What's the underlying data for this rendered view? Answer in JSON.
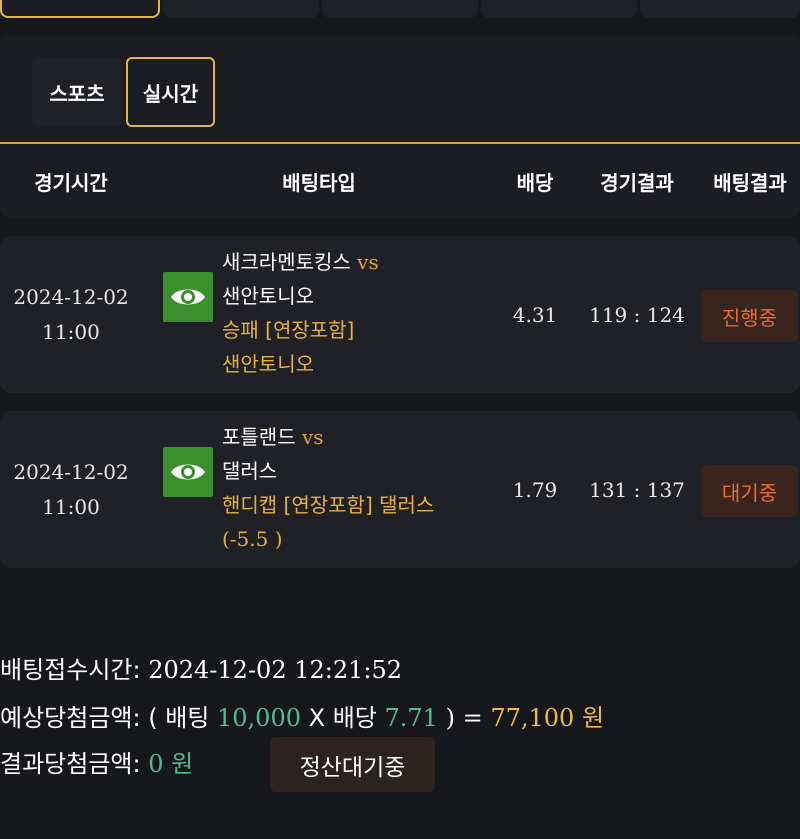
{
  "tabs": {
    "sports_label": "스포츠",
    "live_label": "실시간"
  },
  "table_headers": {
    "time": "경기시간",
    "bet_type": "배팅타입",
    "odds": "배당",
    "game_result": "경기결과",
    "bet_result": "배팅결과"
  },
  "bets": [
    {
      "date": "2024-12-02",
      "time": "11:00",
      "home": "새크라멘토킹스",
      "vs": "vs",
      "away": "샌안토니오",
      "market": "승패 [연장포함]",
      "pick": "샌안토니오",
      "odds": "4.31",
      "score": "119 : 124",
      "status": "진행중"
    },
    {
      "date": "2024-12-02",
      "time": "11:00",
      "home": "포틀랜드",
      "vs": "vs",
      "away": "댈러스",
      "market": "핸디캡 [연장포함] 댈러스",
      "pick": "(-5.5 )",
      "odds": "1.79",
      "score": "131 : 137",
      "status": "대기중"
    }
  ],
  "summary": {
    "receipt_label": "배팅접수시간:",
    "receipt_time": "2024-12-02 12:21:52",
    "expected_label": "예상당첨금액:",
    "expected_open": "( 배팅",
    "stake": "10,000",
    "times": "X 배당",
    "total_odds": "7.71",
    "equals": ") =",
    "payout": "77,100 원",
    "result_label": "결과당첨금액:",
    "result_value": "0 원",
    "settle_status": "정산대기중"
  },
  "icons": {
    "eye": "eye-icon"
  },
  "colors": {
    "accent_gold": "#e8b53a",
    "eye_button_green": "#3b8f2c",
    "status_orange": "#ee6a2e",
    "value_green": "#4cbf8c",
    "payout_yellow": "#f0b93d"
  }
}
